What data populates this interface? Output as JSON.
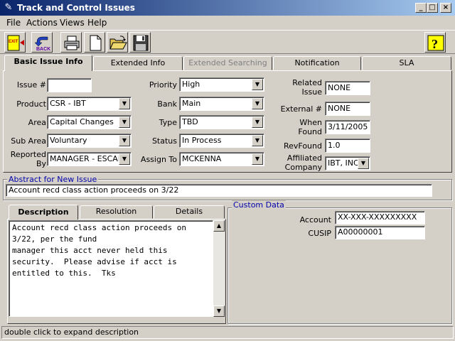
{
  "window": {
    "title": "Track and Control Issues",
    "minimize_glyph": "_",
    "maximize_glyph": "□",
    "close_glyph": "×"
  },
  "menu": [
    {
      "label": "File",
      "key": "F"
    },
    {
      "label": "Actions",
      "key": "A"
    },
    {
      "label": "Views",
      "key": "V"
    },
    {
      "label": "Help",
      "key": "H"
    }
  ],
  "toolbar": {
    "exit_label": "EXIT",
    "back_label": "BACK",
    "help_glyph": "?",
    "icons": [
      "exit-icon",
      "back-icon",
      "print-icon",
      "new-document-icon",
      "open-folder-icon",
      "save-icon",
      "help-icon"
    ]
  },
  "tabs": [
    "Basic Issue Info",
    "Extended Info",
    "Extended Searching",
    "Notification",
    "SLA"
  ],
  "basic": {
    "issue_num_label": "Issue #",
    "issue_num_value": "",
    "product_label": "Product",
    "product_value": "CSR - IBT",
    "area_label": "Area",
    "area_value": "Capital Changes",
    "subarea_label": "Sub Area",
    "subarea_value": "Voluntary",
    "reported_label": "Reported By",
    "reported_value": "MANAGER - ESCAL/",
    "priority_label": "Priority",
    "priority_value": "High",
    "bank_label": "Bank",
    "bank_value": "Main",
    "type_label": "Type",
    "type_value": "TBD",
    "status_label": "Status",
    "status_value": "In Process",
    "assign_label": "Assign To",
    "assign_value": "MCKENNA",
    "related_label": "Related Issue",
    "related_value": "NONE",
    "external_label": "External #",
    "external_value": "NONE",
    "when_label": "When Found",
    "when_value": "3/11/2005",
    "revfound_label": "RevFound",
    "revfound_value": "1.0",
    "affiliated_label": "Affiliated Company",
    "affiliated_value": "IBT, INC"
  },
  "abstract": {
    "legend": "Abstract for New Issue",
    "value": "Account recd class action proceeds on 3/22"
  },
  "desc_tabs": [
    "Description",
    "Resolution",
    "Details"
  ],
  "description_text": "Account recd class action proceeds on\n3/22, per the fund\nmanager this acct never held this\nsecurity.  Please advise if acct is\nentitled to this.  Tks",
  "custom": {
    "legend": "Custom Data",
    "account_label": "Account",
    "account_value": "XX-XXX-XXXXXXXXX",
    "cusip_label": "CUSIP",
    "cusip_value": "A00000001"
  },
  "status_text": "double click to expand description",
  "colors": {
    "titlebar_start": "#0a246a",
    "titlebar_end": "#a6caf0",
    "legend_blue": "#0000aa",
    "face": "#d4d0c8"
  }
}
